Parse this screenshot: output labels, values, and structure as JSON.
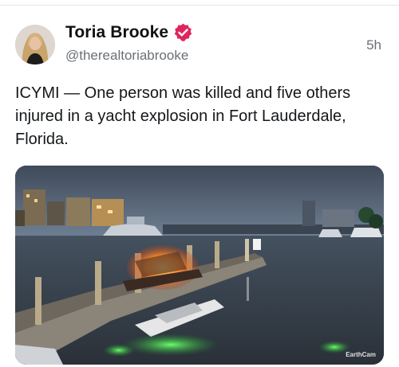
{
  "tweet": {
    "author": {
      "name": "Toria Brooke",
      "handle": "@therealtoriabrooke",
      "verified_icon": "verified-badge-icon",
      "verified_color": "#e0245e"
    },
    "timestamp": "5h",
    "text": "ICYMI — One person was killed and five others injured in a yacht explosion in Fort Lauderdale, Florida.",
    "media": {
      "watermark": "EarthCam"
    }
  }
}
